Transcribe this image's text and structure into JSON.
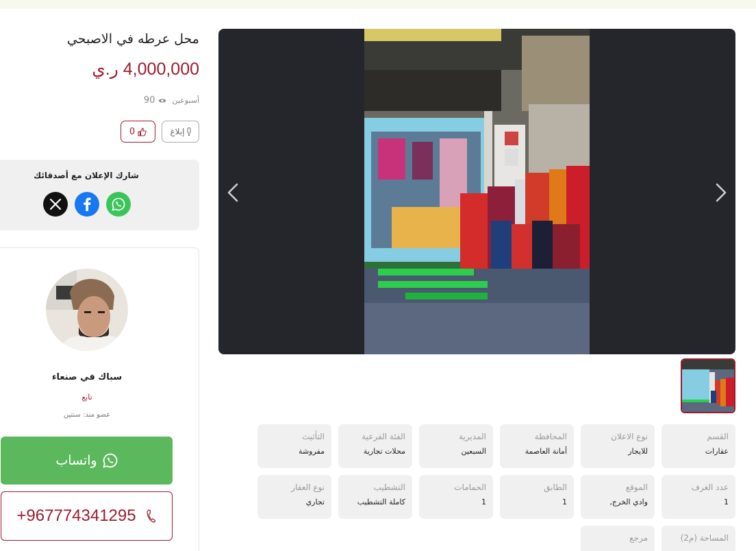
{
  "listing": {
    "title": "محل عرطه في الاصبحي",
    "price": "4,000,000 ر.ي",
    "posted": "أسبوعين",
    "views": "90",
    "report_label": "إبلاغ",
    "likes": "0"
  },
  "share": {
    "title": "شارك الإعلان مع أصدقائك"
  },
  "seller": {
    "name": "سباك في صنعاء",
    "follow_label": "تابع",
    "member_since": "عضو منذ: سنتين"
  },
  "contact": {
    "whatsapp_label": "واتساب",
    "phone": "+967774341295"
  },
  "details": [
    {
      "label": "القسم",
      "value": "عقارات"
    },
    {
      "label": "نوع الاعلان",
      "value": "للايجار"
    },
    {
      "label": "المحافظة",
      "value": "أمانة العاصمة"
    },
    {
      "label": "المديرية",
      "value": "السبعين"
    },
    {
      "label": "الفئة الفرعية",
      "value": "محلات تجارية"
    },
    {
      "label": "التأثيث",
      "value": "مفروشة"
    },
    {
      "label": "عدد الغرف",
      "value": "1"
    },
    {
      "label": "الموقع",
      "value": "وادي الخرج,"
    },
    {
      "label": "الطابق",
      "value": "1"
    },
    {
      "label": "الحمامات",
      "value": "1"
    },
    {
      "label": "التشطيب",
      "value": "كاملة التشطيب"
    },
    {
      "label": "نوع العقار",
      "value": "تجاري"
    },
    {
      "label": "المساحة (م2)",
      "value": ""
    },
    {
      "label": "مرجع",
      "value": ""
    }
  ],
  "icons": {
    "prev": "chevron-left-icon",
    "next": "chevron-right-icon",
    "eye": "eye-icon",
    "report": "exclamation-icon",
    "like": "thumbs-up-icon",
    "whatsapp": "whatsapp-icon",
    "facebook": "facebook-icon",
    "x": "x-icon",
    "phone": "phone-icon"
  },
  "colors": {
    "accent": "#9b1c2e",
    "whatsapp": "#5cb85c",
    "facebook": "#1877f2",
    "gallery_bg": "#25262b",
    "card_bg": "#f0f0f0"
  }
}
